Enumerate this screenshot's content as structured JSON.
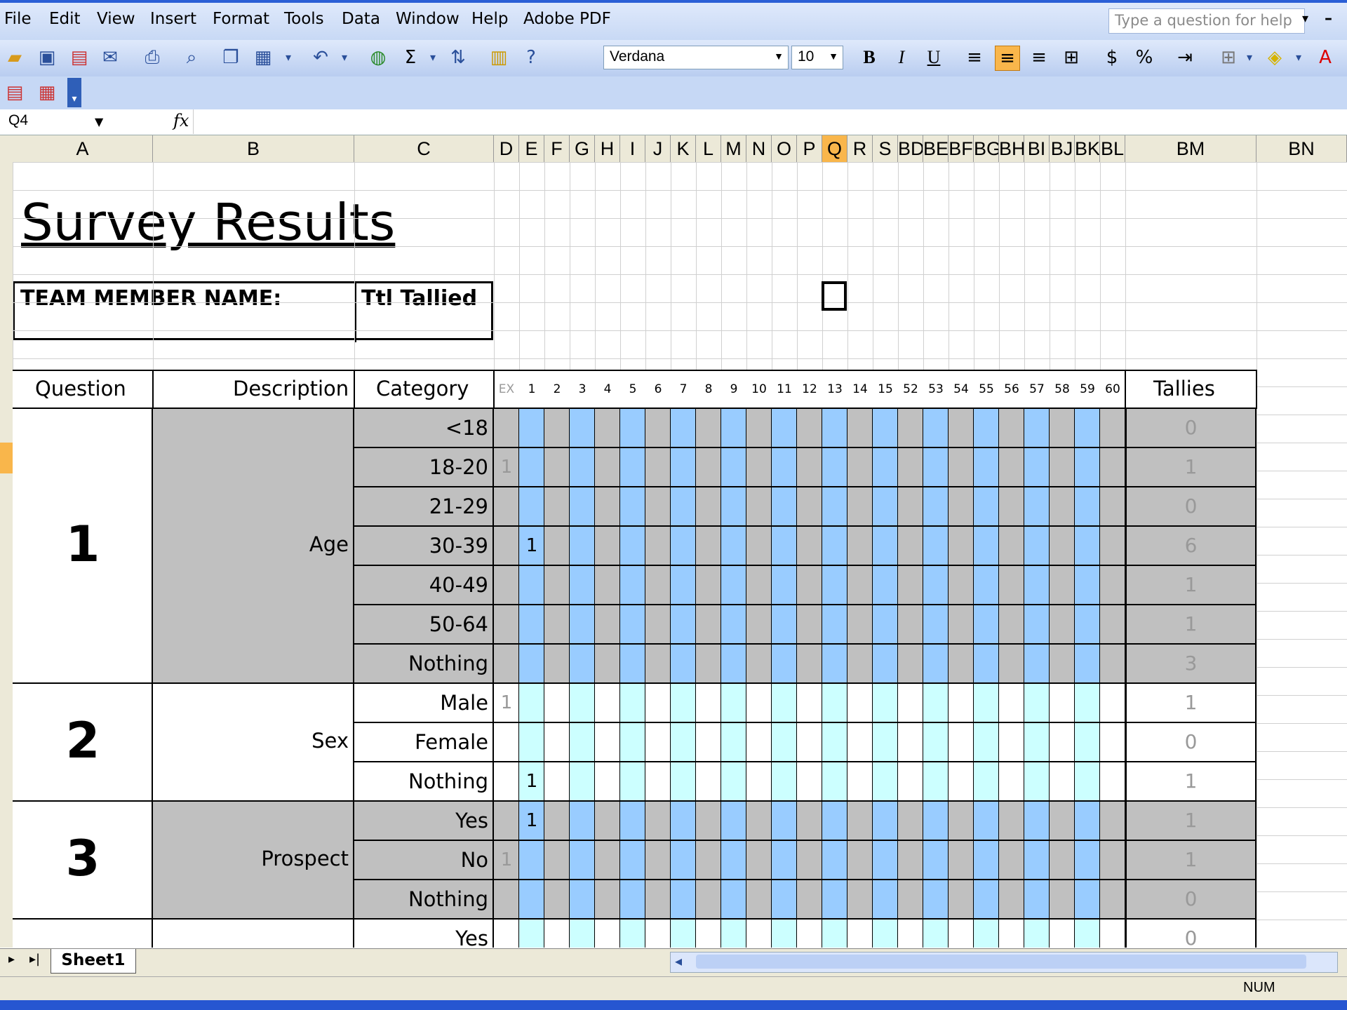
{
  "menu": [
    "File",
    "Edit",
    "View",
    "Insert",
    "Format",
    "Tools",
    "Data",
    "Window",
    "Help",
    "Adobe PDF"
  ],
  "help_placeholder": "Type a question for help",
  "font_name": "Verdana",
  "font_size": "10",
  "name_box": "Q4",
  "fx": "fx",
  "columns": [
    "A",
    "B",
    "C",
    "D",
    "E",
    "F",
    "G",
    "H",
    "I",
    "J",
    "K",
    "L",
    "M",
    "N",
    "O",
    "P",
    "Q",
    "R",
    "S",
    "BD",
    "BE",
    "BF",
    "BG",
    "BH",
    "BI",
    "BJ",
    "BK",
    "BL",
    "BM",
    "BN"
  ],
  "title": "Survey Results",
  "team_member_label": "TEAM MEMBER NAME:",
  "ttl_tallied_label": "Ttl Tallied",
  "headers": {
    "question": "Question",
    "description": "Description",
    "category": "Category",
    "ex": "EX",
    "tallies": "Tallies"
  },
  "day_numbers": [
    "1",
    "2",
    "3",
    "4",
    "5",
    "6",
    "7",
    "8",
    "9",
    "10",
    "11",
    "12",
    "13",
    "14",
    "15",
    "52",
    "53",
    "54",
    "55",
    "56",
    "57",
    "58",
    "59",
    "60"
  ],
  "questions": [
    {
      "num": "1",
      "desc": "Age",
      "rows": [
        {
          "cat": "<18",
          "ex": "",
          "d1": "",
          "tally": "0"
        },
        {
          "cat": "18-20",
          "ex": "1",
          "d1": "",
          "tally": "1"
        },
        {
          "cat": "21-29",
          "ex": "",
          "d1": "",
          "tally": "0"
        },
        {
          "cat": "30-39",
          "ex": "",
          "d1": "1",
          "tally": "6"
        },
        {
          "cat": "40-49",
          "ex": "",
          "d1": "",
          "tally": "1"
        },
        {
          "cat": "50-64",
          "ex": "",
          "d1": "",
          "tally": "1"
        },
        {
          "cat": "Nothing",
          "ex": "",
          "d1": "",
          "tally": "3"
        }
      ]
    },
    {
      "num": "2",
      "desc": "Sex",
      "rows": [
        {
          "cat": "Male",
          "ex": "1",
          "d1": "",
          "tally": "1"
        },
        {
          "cat": "Female",
          "ex": "",
          "d1": "",
          "tally": "0"
        },
        {
          "cat": "Nothing",
          "ex": "",
          "d1": "1",
          "tally": "1"
        }
      ]
    },
    {
      "num": "3",
      "desc": "Prospect",
      "rows": [
        {
          "cat": "Yes",
          "ex": "",
          "d1": "1",
          "tally": "1"
        },
        {
          "cat": "No",
          "ex": "1",
          "d1": "",
          "tally": "1"
        },
        {
          "cat": "Nothing",
          "ex": "",
          "d1": "",
          "tally": "0"
        }
      ]
    },
    {
      "num": "",
      "desc": "",
      "rows": [
        {
          "cat": "Yes",
          "ex": "",
          "d1": "",
          "tally": "0"
        }
      ]
    }
  ],
  "sheet_tab": "Sheet1",
  "status_num": "NUM",
  "colors": {
    "grey": "#c0c0c0",
    "blue": "#99ccff",
    "cyan": "#ccffff",
    "accent": "#f9b64b"
  }
}
